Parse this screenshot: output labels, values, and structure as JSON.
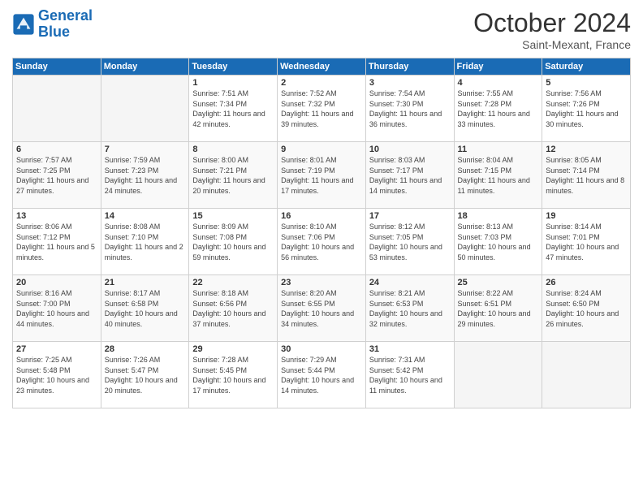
{
  "logo": {
    "line1": "General",
    "line2": "Blue"
  },
  "header": {
    "month": "October 2024",
    "location": "Saint-Mexant, France"
  },
  "weekdays": [
    "Sunday",
    "Monday",
    "Tuesday",
    "Wednesday",
    "Thursday",
    "Friday",
    "Saturday"
  ],
  "weeks": [
    [
      {
        "day": "",
        "sunrise": "",
        "sunset": "",
        "daylight": ""
      },
      {
        "day": "",
        "sunrise": "",
        "sunset": "",
        "daylight": ""
      },
      {
        "day": "1",
        "sunrise": "Sunrise: 7:51 AM",
        "sunset": "Sunset: 7:34 PM",
        "daylight": "Daylight: 11 hours and 42 minutes."
      },
      {
        "day": "2",
        "sunrise": "Sunrise: 7:52 AM",
        "sunset": "Sunset: 7:32 PM",
        "daylight": "Daylight: 11 hours and 39 minutes."
      },
      {
        "day": "3",
        "sunrise": "Sunrise: 7:54 AM",
        "sunset": "Sunset: 7:30 PM",
        "daylight": "Daylight: 11 hours and 36 minutes."
      },
      {
        "day": "4",
        "sunrise": "Sunrise: 7:55 AM",
        "sunset": "Sunset: 7:28 PM",
        "daylight": "Daylight: 11 hours and 33 minutes."
      },
      {
        "day": "5",
        "sunrise": "Sunrise: 7:56 AM",
        "sunset": "Sunset: 7:26 PM",
        "daylight": "Daylight: 11 hours and 30 minutes."
      }
    ],
    [
      {
        "day": "6",
        "sunrise": "Sunrise: 7:57 AM",
        "sunset": "Sunset: 7:25 PM",
        "daylight": "Daylight: 11 hours and 27 minutes."
      },
      {
        "day": "7",
        "sunrise": "Sunrise: 7:59 AM",
        "sunset": "Sunset: 7:23 PM",
        "daylight": "Daylight: 11 hours and 24 minutes."
      },
      {
        "day": "8",
        "sunrise": "Sunrise: 8:00 AM",
        "sunset": "Sunset: 7:21 PM",
        "daylight": "Daylight: 11 hours and 20 minutes."
      },
      {
        "day": "9",
        "sunrise": "Sunrise: 8:01 AM",
        "sunset": "Sunset: 7:19 PM",
        "daylight": "Daylight: 11 hours and 17 minutes."
      },
      {
        "day": "10",
        "sunrise": "Sunrise: 8:03 AM",
        "sunset": "Sunset: 7:17 PM",
        "daylight": "Daylight: 11 hours and 14 minutes."
      },
      {
        "day": "11",
        "sunrise": "Sunrise: 8:04 AM",
        "sunset": "Sunset: 7:15 PM",
        "daylight": "Daylight: 11 hours and 11 minutes."
      },
      {
        "day": "12",
        "sunrise": "Sunrise: 8:05 AM",
        "sunset": "Sunset: 7:14 PM",
        "daylight": "Daylight: 11 hours and 8 minutes."
      }
    ],
    [
      {
        "day": "13",
        "sunrise": "Sunrise: 8:06 AM",
        "sunset": "Sunset: 7:12 PM",
        "daylight": "Daylight: 11 hours and 5 minutes."
      },
      {
        "day": "14",
        "sunrise": "Sunrise: 8:08 AM",
        "sunset": "Sunset: 7:10 PM",
        "daylight": "Daylight: 11 hours and 2 minutes."
      },
      {
        "day": "15",
        "sunrise": "Sunrise: 8:09 AM",
        "sunset": "Sunset: 7:08 PM",
        "daylight": "Daylight: 10 hours and 59 minutes."
      },
      {
        "day": "16",
        "sunrise": "Sunrise: 8:10 AM",
        "sunset": "Sunset: 7:06 PM",
        "daylight": "Daylight: 10 hours and 56 minutes."
      },
      {
        "day": "17",
        "sunrise": "Sunrise: 8:12 AM",
        "sunset": "Sunset: 7:05 PM",
        "daylight": "Daylight: 10 hours and 53 minutes."
      },
      {
        "day": "18",
        "sunrise": "Sunrise: 8:13 AM",
        "sunset": "Sunset: 7:03 PM",
        "daylight": "Daylight: 10 hours and 50 minutes."
      },
      {
        "day": "19",
        "sunrise": "Sunrise: 8:14 AM",
        "sunset": "Sunset: 7:01 PM",
        "daylight": "Daylight: 10 hours and 47 minutes."
      }
    ],
    [
      {
        "day": "20",
        "sunrise": "Sunrise: 8:16 AM",
        "sunset": "Sunset: 7:00 PM",
        "daylight": "Daylight: 10 hours and 44 minutes."
      },
      {
        "day": "21",
        "sunrise": "Sunrise: 8:17 AM",
        "sunset": "Sunset: 6:58 PM",
        "daylight": "Daylight: 10 hours and 40 minutes."
      },
      {
        "day": "22",
        "sunrise": "Sunrise: 8:18 AM",
        "sunset": "Sunset: 6:56 PM",
        "daylight": "Daylight: 10 hours and 37 minutes."
      },
      {
        "day": "23",
        "sunrise": "Sunrise: 8:20 AM",
        "sunset": "Sunset: 6:55 PM",
        "daylight": "Daylight: 10 hours and 34 minutes."
      },
      {
        "day": "24",
        "sunrise": "Sunrise: 8:21 AM",
        "sunset": "Sunset: 6:53 PM",
        "daylight": "Daylight: 10 hours and 32 minutes."
      },
      {
        "day": "25",
        "sunrise": "Sunrise: 8:22 AM",
        "sunset": "Sunset: 6:51 PM",
        "daylight": "Daylight: 10 hours and 29 minutes."
      },
      {
        "day": "26",
        "sunrise": "Sunrise: 8:24 AM",
        "sunset": "Sunset: 6:50 PM",
        "daylight": "Daylight: 10 hours and 26 minutes."
      }
    ],
    [
      {
        "day": "27",
        "sunrise": "Sunrise: 7:25 AM",
        "sunset": "Sunset: 5:48 PM",
        "daylight": "Daylight: 10 hours and 23 minutes."
      },
      {
        "day": "28",
        "sunrise": "Sunrise: 7:26 AM",
        "sunset": "Sunset: 5:47 PM",
        "daylight": "Daylight: 10 hours and 20 minutes."
      },
      {
        "day": "29",
        "sunrise": "Sunrise: 7:28 AM",
        "sunset": "Sunset: 5:45 PM",
        "daylight": "Daylight: 10 hours and 17 minutes."
      },
      {
        "day": "30",
        "sunrise": "Sunrise: 7:29 AM",
        "sunset": "Sunset: 5:44 PM",
        "daylight": "Daylight: 10 hours and 14 minutes."
      },
      {
        "day": "31",
        "sunrise": "Sunrise: 7:31 AM",
        "sunset": "Sunset: 5:42 PM",
        "daylight": "Daylight: 10 hours and 11 minutes."
      },
      {
        "day": "",
        "sunrise": "",
        "sunset": "",
        "daylight": ""
      },
      {
        "day": "",
        "sunrise": "",
        "sunset": "",
        "daylight": ""
      }
    ]
  ]
}
